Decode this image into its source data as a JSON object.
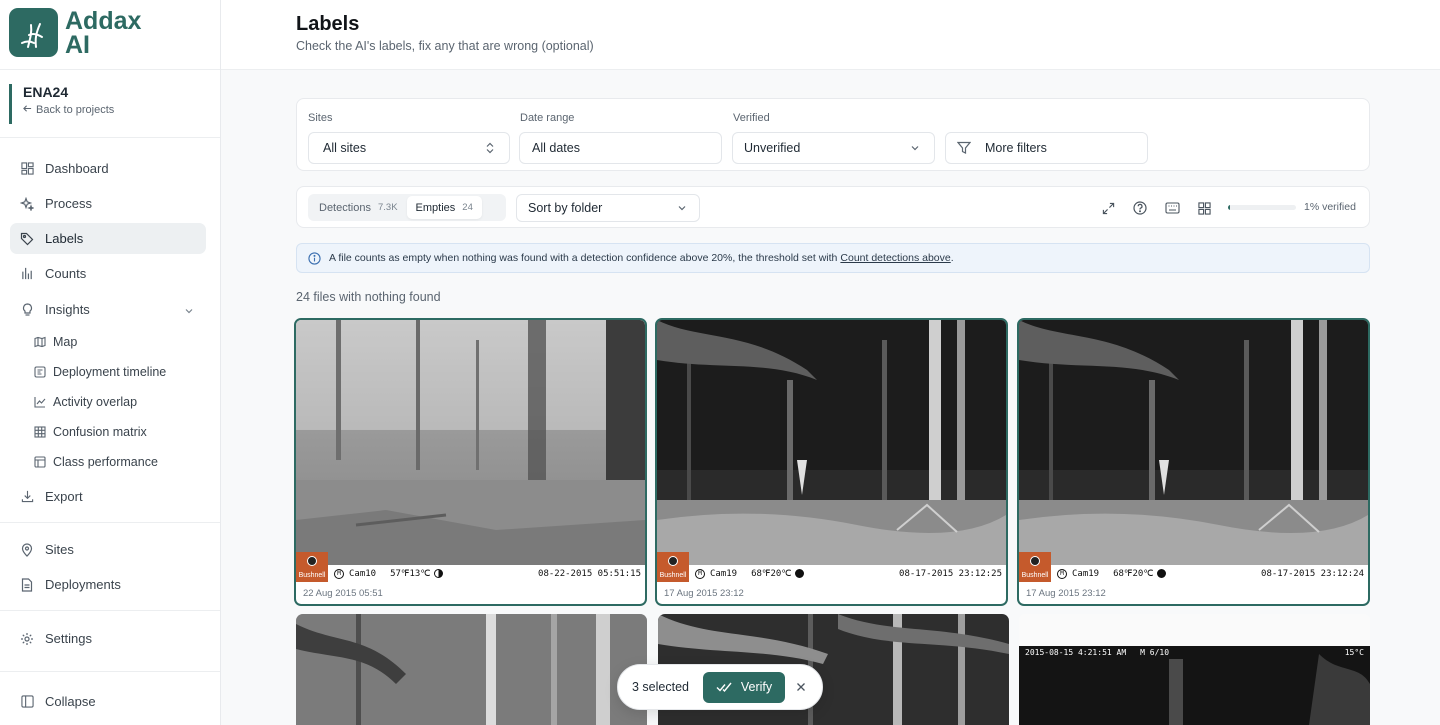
{
  "app": {
    "logo_line1": "Addax",
    "logo_line2": "AI"
  },
  "project": {
    "name": "ENA24",
    "back_label": "Back to projects"
  },
  "nav": {
    "dashboard": "Dashboard",
    "process": "Process",
    "labels": "Labels",
    "counts": "Counts",
    "insights": "Insights",
    "map": "Map",
    "deployment_timeline": "Deployment timeline",
    "activity_overlap": "Activity overlap",
    "confusion_matrix": "Confusion matrix",
    "class_performance": "Class performance",
    "export": "Export",
    "sites": "Sites",
    "deployments": "Deployments",
    "settings": "Settings",
    "collapse": "Collapse"
  },
  "header": {
    "title": "Labels",
    "subtitle": "Check the AI's labels, fix any that are wrong (optional)"
  },
  "filters": {
    "sites_label": "Sites",
    "sites_value": "All sites",
    "date_label": "Date range",
    "date_value": "All dates",
    "verified_label": "Verified",
    "verified_value": "Unverified",
    "more_filters": "More filters"
  },
  "toolbar": {
    "detections_label": "Detections",
    "detections_count": "7.3K",
    "empties_label": "Empties",
    "empties_count": "24",
    "sort_value": "Sort by folder",
    "verified_fraction": 0.01,
    "verified_text": "1% verified"
  },
  "banner": {
    "text": "A file counts as empty when nothing was found with a detection confidence above 20%, the threshold set with",
    "link": "Count detections above",
    "end": "."
  },
  "results": {
    "count_text": "24 files with nothing found"
  },
  "cards": [
    {
      "cam": "Cam10",
      "temp": "57℉13℃",
      "timestamp": "08-22-2015 05:51:15",
      "caption": "22 Aug 2015 05:51",
      "brand": "Bushnell",
      "mode": "M"
    },
    {
      "cam": "Cam19",
      "temp": "68℉20℃",
      "timestamp": "08-17-2015 23:12:25",
      "caption": "17 Aug 2015 23:12",
      "brand": "Bushnell",
      "mode": "M"
    },
    {
      "cam": "Cam19",
      "temp": "68℉20℃",
      "timestamp": "08-17-2015 23:12:24",
      "caption": "17 Aug 2015 23:12",
      "brand": "Bushnell",
      "mode": "M"
    }
  ],
  "card6_stamp": {
    "timestamp": "2015-08-15 4:21:51 AM",
    "mode": "M 6/10",
    "temp": "15°C"
  },
  "selection": {
    "count_text": "3 selected",
    "verify_label": "Verify"
  },
  "colors": {
    "accent": "#2d6a62",
    "brand_orange": "#c55a2c",
    "banner_bg": "#eef4fb"
  }
}
